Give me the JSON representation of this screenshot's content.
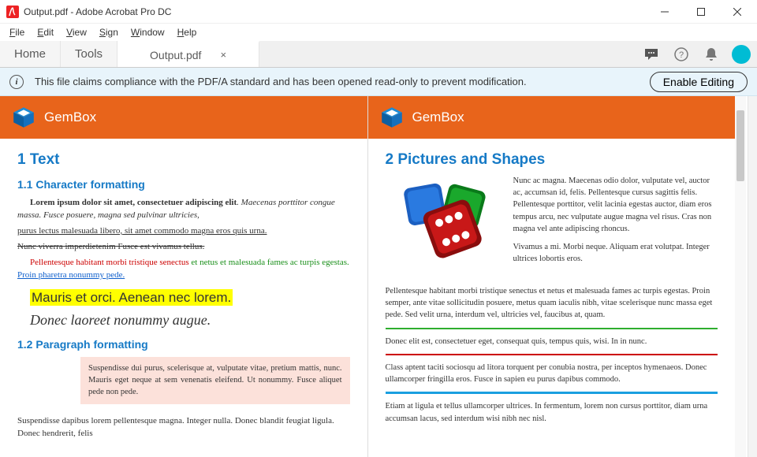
{
  "window": {
    "title": "Output.pdf - Adobe Acrobat Pro DC"
  },
  "menu": [
    "File",
    "Edit",
    "View",
    "Sign",
    "Window",
    "Help"
  ],
  "tabs": {
    "home": "Home",
    "tools": "Tools",
    "doc": "Output.pdf"
  },
  "infobar": {
    "message": "This file claims compliance with the PDF/A standard and has been opened read-only to prevent modification.",
    "button": "Enable Editing"
  },
  "colors": {
    "orange": "#e8641b",
    "blue_heading": "#167ac6"
  },
  "page1": {
    "brand": "GemBox",
    "h1": "1  Text",
    "h2a": "1.1  Character formatting",
    "line1_a": "Lorem ipsum dolor sit amet, consectetuer adipiscing elit",
    "line1_b": ". Maecenas porttitor congue massa. Fusce posuere, magna sed pulvinar ultricies,",
    "line2_a": "purus lectus malesuada libero,",
    "line2_b": " sit amet commodo magna eros quis urna.",
    "line3": "Nunc viverra imperdietenim Fusce est vivamus tellus.",
    "line4_a": "Pellentesque habitant morbi tristique senectus",
    "line4_b": " et netus et malesuada fames ac turpis egestas.",
    "line4_c": " Proin pharetra nonummy pede.",
    "highlight": "Mauris et orci. Aenean nec lorem.",
    "script": "Donec laoreet nonummy augue.",
    "h2b": "1.2  Paragraph formatting",
    "box": "Suspendisse dui purus, scelerisque at, vulputate vitae, pretium mattis, nunc. Mauris eget neque at sem venenatis eleifend. Ut nonummy. Fusce aliquet pede non pede.",
    "tail": "Suspendisse dapibus lorem pellentesque magna. Integer nulla. Donec blandit feugiat ligula. Donec hendrerit, felis"
  },
  "page2": {
    "brand": "GemBox",
    "h1": "2  Pictures and Shapes",
    "side": "Nunc ac magna. Maecenas odio dolor, vulputate vel, auctor ac, accumsan id, felis. Pellentesque cursus sagittis felis. Pellentesque porttitor, velit lacinia egestas auctor, diam eros tempus arcu, nec vulputate augue magna vel risus. Cras non magna vel ante adipiscing rhoncus.",
    "side2": "Vivamus a mi. Morbi neque. Aliquam erat volutpat. Integer ultrices lobortis eros.",
    "para1": "Pellentesque habitant morbi tristique senectus et netus et malesuada fames ac turpis egestas. Proin semper, ante vitae sollicitudin posuere, metus quam iaculis nibh, vitae scelerisque nunc massa eget pede. Sed velit urna, interdum vel, ultricies vel, faucibus at, quam.",
    "para2": "Donec elit est, consectetuer eget, consequat quis, tempus quis, wisi. In in nunc.",
    "para3": "Class aptent taciti sociosqu ad litora torquent per conubia nostra, per inceptos hymenaeos. Donec ullamcorper fringilla eros. Fusce in sapien eu purus dapibus commodo.",
    "para4": "Etiam at ligula et tellus ullamcorper ultrices. In fermentum, lorem non cursus porttitor, diam urna accumsan lacus, sed interdum wisi nibh nec nisl."
  }
}
